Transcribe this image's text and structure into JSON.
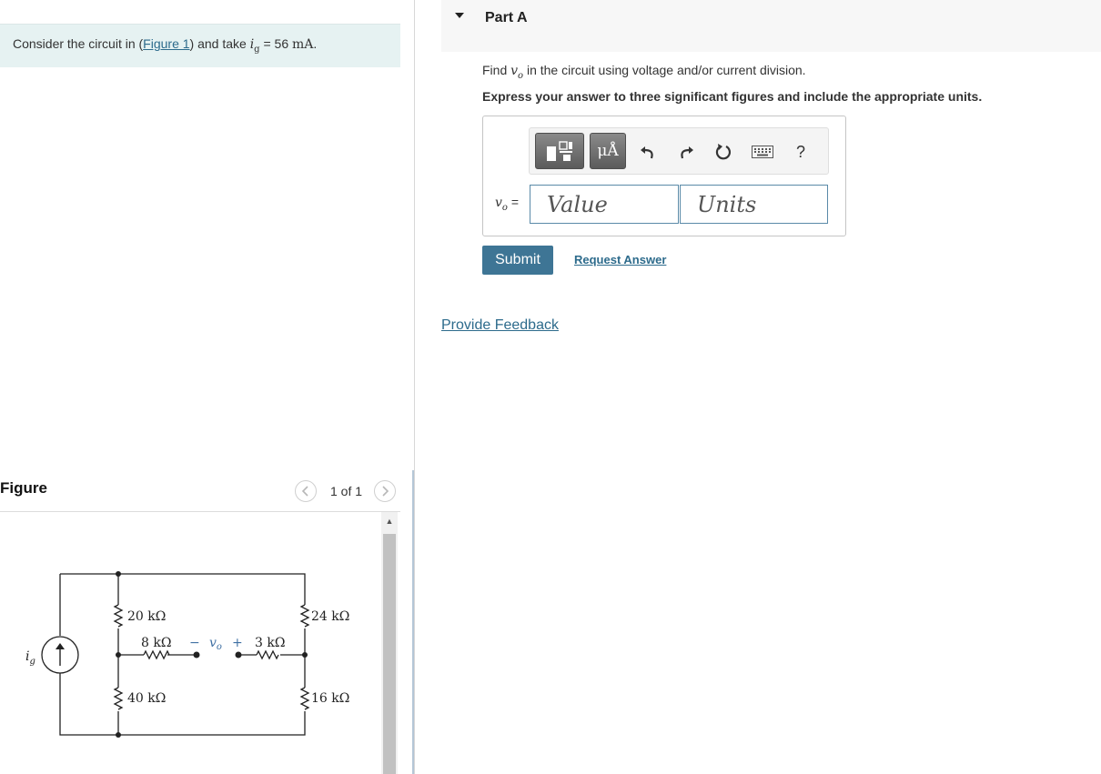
{
  "problem": {
    "prefix": "Consider the circuit in (",
    "figure_link": "Figure 1",
    "middle": ") and take ",
    "var_main": "i",
    "var_sub": "g",
    "equals": " = 56 ",
    "unit": "mA",
    "suffix": "."
  },
  "figure": {
    "title": "Figure",
    "counter": "1 of 1",
    "prev_icon": "chevron-left-icon",
    "next_icon": "chevron-right-icon",
    "circuit": {
      "source_label_main": "i",
      "source_label_sub": "g",
      "r_top_left": "20 kΩ",
      "r_mid_left": "8 kΩ",
      "vo_minus": "−",
      "vo_label": "v",
      "vo_sub": "o",
      "vo_plus": "+",
      "r_mid_right": "3 kΩ",
      "r_top_right": "24 kΩ",
      "r_bot_left": "40 kΩ",
      "r_bot_right": "16 kΩ"
    }
  },
  "part": {
    "title": "Part A",
    "caret_icon": "caret-down-icon",
    "question_prefix": "Find ",
    "question_var": "v",
    "question_sub": "o",
    "question_suffix": " in the circuit using voltage and/or current division.",
    "instruction": "Express your answer to three significant figures and include the appropriate units."
  },
  "toolbar": {
    "templates_icon": "templates-icon",
    "units_tool_label": "μÅ",
    "undo_icon": "undo-icon",
    "redo_icon": "redo-icon",
    "reset_icon": "reset-icon",
    "keyboard_icon": "keyboard-icon",
    "help_label": "?"
  },
  "answer": {
    "label_var": "v",
    "label_sub": "o",
    "label_eq": " =",
    "value_placeholder": "Value",
    "units_placeholder": "Units"
  },
  "actions": {
    "submit_label": "Submit",
    "request_answer_label": "Request Answer",
    "feedback_label": "Provide Feedback"
  },
  "colors": {
    "accent": "#3e7595",
    "link": "#2d6b8c",
    "problem_bg": "#e6f2f2"
  }
}
